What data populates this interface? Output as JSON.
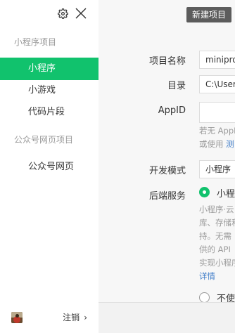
{
  "sidebar": {
    "sections": [
      {
        "title": "小程序项目",
        "items": [
          {
            "label": "小程序",
            "active": true
          },
          {
            "label": "小游戏",
            "active": false
          },
          {
            "label": "代码片段",
            "active": false
          }
        ]
      },
      {
        "title": "公众号网页项目",
        "items": [
          {
            "label": "公众号网页",
            "active": false
          }
        ]
      }
    ],
    "footer": {
      "logout_label": "注销",
      "chevron": "›"
    }
  },
  "main": {
    "new_button": "新建项目",
    "form": {
      "project_name_label": "项目名称",
      "project_name_value": "miniprog",
      "directory_label": "目录",
      "directory_value": "C:\\User",
      "appid_label": "AppID",
      "appid_value": "",
      "appid_hint_line1": "若无 AppI",
      "appid_hint_line2_prefix": "或使用 ",
      "appid_hint_link": "测",
      "dev_mode_label": "开发模式",
      "dev_mode_value": "小程序",
      "backend_label": "后端服务",
      "backend_option_cloud": "小程",
      "backend_option_none": "不使",
      "backend_desc_lines": [
        "小程序·云",
        "库、存储和",
        "持。无需",
        "供的 API",
        "实现小程序"
      ],
      "backend_desc_link": "详情"
    }
  },
  "colors": {
    "accent": "#11c26d",
    "link": "#3d7bc8",
    "button": "#5c5c5c"
  },
  "icons": {
    "settings": "gear-icon",
    "close": "close-icon"
  }
}
